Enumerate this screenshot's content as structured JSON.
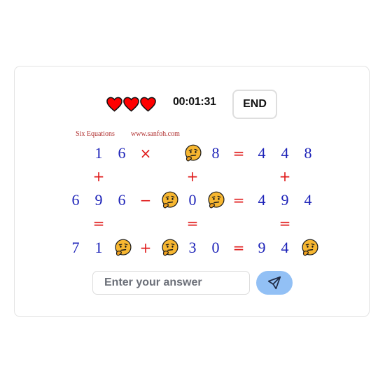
{
  "header": {
    "lives": 3,
    "lives_icon": "heart-icon",
    "timer": "00:01:31",
    "end_label": "END"
  },
  "captions": {
    "title": "Six Equations",
    "site": "www.sanfoh.com"
  },
  "puzzle": {
    "row1": [
      "1",
      "6",
      "×",
      "?",
      "8",
      "=",
      "4",
      "4",
      "8"
    ],
    "col_ops_1": [
      "+",
      "+",
      "+"
    ],
    "row2": [
      "6",
      "9",
      "6",
      "−",
      "?",
      "0",
      "?",
      "=",
      "4",
      "9",
      "4"
    ],
    "col_ops_2": [
      "=",
      "=",
      "="
    ],
    "row3": [
      "7",
      "1",
      "?",
      "+",
      "?",
      "3",
      "0",
      "=",
      "9",
      "4",
      "?"
    ],
    "unknown_icon": "thinking-face-icon"
  },
  "input": {
    "placeholder": "Enter your answer",
    "value": ""
  },
  "send_icon": "send-icon",
  "colors": {
    "digit": "#1c22b8",
    "operator": "#e01b1b",
    "heart": "#ff0000",
    "send_button": "#92c0f5"
  }
}
